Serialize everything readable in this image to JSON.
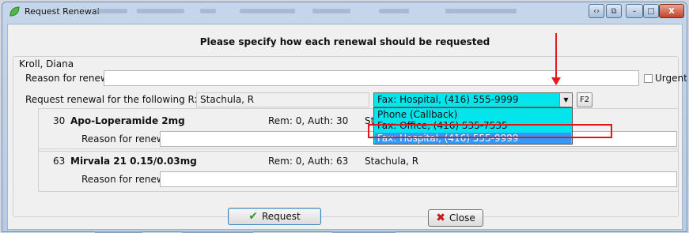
{
  "window": {
    "title": "Request Renewal",
    "controls": {
      "nav": "‹›",
      "restore": "⧉",
      "minimize": "–",
      "maximize": "□",
      "close": "X"
    }
  },
  "heading": "Please specify how each renewal should be requested",
  "patient": {
    "name": "Kroll, Diana"
  },
  "renewal": {
    "reason_label": "Reason for renewal",
    "reason_value": "",
    "urgent_label": "Urgent",
    "urgent_checked": false,
    "request_label": "Request renewal for the following Rxs from",
    "prescriber": "Stachula, R",
    "method_selected": "Fax: Hospital, (416) 555-9999",
    "f2_label": "F2",
    "method_options": [
      "Phone (Callback)",
      "Fax: Office, (416) 535-7535",
      "Fax: Hospital, (416) 555-9999"
    ],
    "highlighted_option_index": 2
  },
  "rxs": [
    {
      "qty": "30",
      "name": "Apo-Loperamide 2mg",
      "rem_auth": "Rem: 0, Auth: 30",
      "prescriber": "Sta",
      "reason_label": "Reason for renewal",
      "reason_value": ""
    },
    {
      "qty": "63",
      "name": "Mirvala 21 0.15/0.03mg",
      "rem_auth": "Rem: 0, Auth: 63",
      "prescriber": "Stachula, R",
      "reason_label": "Reason for renewal",
      "reason_value": ""
    }
  ],
  "buttons": {
    "request": "Request",
    "close": "Close"
  },
  "icons": {
    "app": "leaf-icon",
    "request": "checkmark-icon",
    "close": "x-icon"
  },
  "colors": {
    "dropdown_bg": "#00e5ee",
    "selection": "#3399ff",
    "annotation": "#e01818"
  }
}
